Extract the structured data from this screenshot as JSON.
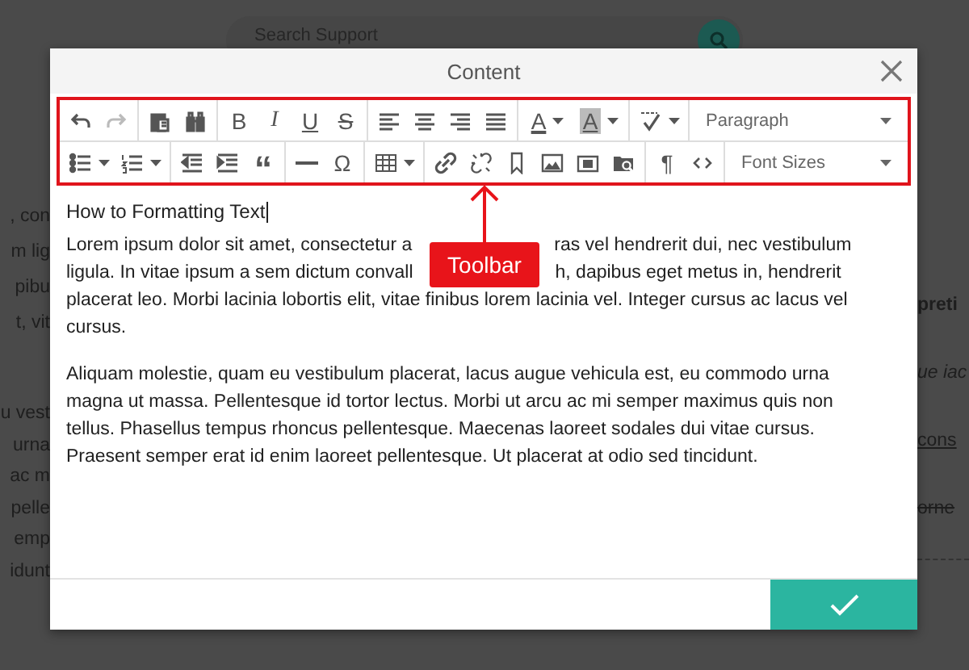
{
  "background": {
    "search": {
      "placeholder": "Search Support"
    },
    "left_fragments": [
      [
        ", con",
        "m lig",
        "pibu",
        "t, vit"
      ],
      [
        "u vest",
        "urna",
        "ac m",
        "pelle",
        "emp",
        "idunt"
      ]
    ],
    "right_fragments": [
      {
        "text": "preti",
        "kind": "bold"
      },
      {
        "text": "ue iac",
        "kind": "italic"
      },
      {
        "text": "cons",
        "kind": "underline"
      },
      {
        "text": "orne",
        "kind": "strike"
      }
    ]
  },
  "dialog": {
    "title": "Content",
    "toolbar": {
      "rows": [
        [
          [
            {
              "kind": "button",
              "disabled": false
            },
            {
              "kind": "button",
              "disabled": true
            }
          ],
          [
            {
              "kind": "button",
              "disabled": false
            },
            {
              "kind": "button",
              "disabled": false
            }
          ],
          [
            {
              "kind": "glyph",
              "glyph": "B",
              "disabled": false
            },
            {
              "kind": "glyph",
              "glyph": "I",
              "disabled": false
            },
            {
              "kind": "glyph",
              "glyph": "U",
              "disabled": false
            },
            {
              "kind": "glyph",
              "glyph": "S",
              "disabled": false
            }
          ],
          [
            {
              "kind": "button",
              "disabled": false
            },
            {
              "kind": "button",
              "disabled": false
            },
            {
              "kind": "button",
              "disabled": false
            },
            {
              "kind": "button",
              "disabled": false
            }
          ],
          [
            {
              "kind": "text-color",
              "glyph": "A",
              "disabled": false
            },
            {
              "kind": "highlight-color",
              "glyph": "A",
              "disabled": false
            }
          ],
          [
            {
              "kind": "split",
              "disabled": false
            }
          ],
          [
            {
              "kind": "select",
              "label": "Paragraph"
            }
          ]
        ],
        [
          [
            {
              "kind": "split",
              "disabled": false
            },
            {
              "kind": "split",
              "disabled": false
            }
          ],
          [
            {
              "kind": "button",
              "disabled": false
            },
            {
              "kind": "button",
              "disabled": false
            },
            {
              "kind": "glyph",
              "glyph": "“",
              "disabled": false
            }
          ],
          [
            {
              "kind": "button",
              "disabled": false
            },
            {
              "kind": "glyph",
              "glyph": "Ω",
              "disabled": false
            }
          ],
          [
            {
              "kind": "split",
              "disabled": false
            }
          ],
          [
            {
              "kind": "button",
              "disabled": false
            },
            {
              "kind": "button",
              "disabled": false
            },
            {
              "kind": "button",
              "disabled": false
            },
            {
              "kind": "button",
              "disabled": false
            },
            {
              "kind": "button",
              "disabled": false
            },
            {
              "kind": "button",
              "disabled": false
            }
          ],
          [
            {
              "kind": "glyph",
              "glyph": "¶",
              "disabled": false
            },
            {
              "kind": "button",
              "disabled": false
            }
          ],
          [
            {
              "kind": "select",
              "label": "Font Sizes"
            }
          ]
        ]
      ]
    },
    "editor": {
      "heading": "How to Formatting Text",
      "paragraphs": [
        {
          "lines": [
            {
              "segments": [
                "Lorem ipsum dolor sit amet, consectetur a",
                "ras vel hendrerit dui, nec vestibulum"
              ]
            },
            {
              "segments": [
                "ligula. In vitae ipsum a sem dictum convall",
                "h, dapibus eget metus in, hendrerit"
              ]
            },
            {
              "segments": [
                "placerat leo. Morbi lacinia lobortis elit, vitae finibus lorem lacinia vel. Integer cursus ac lacus vel"
              ]
            },
            {
              "segments": [
                "cursus."
              ]
            }
          ]
        },
        {
          "lines": [
            {
              "segments": [
                "Aliquam molestie, quam eu vestibulum placerat, lacus augue vehicula est, eu commodo urna"
              ]
            },
            {
              "segments": [
                "magna ut massa. Pellentesque id tortor lectus. Morbi ut arcu ac mi semper maximus quis non"
              ]
            },
            {
              "segments": [
                "tellus. Phasellus tempus rhoncus pellentesque. Maecenas laoreet sodales dui vitae cursus."
              ]
            },
            {
              "segments": [
                "Praesent semper erat id enim laoreet pellentesque. Ut placerat at odio sed tincidunt."
              ]
            }
          ]
        }
      ]
    },
    "annotation": {
      "label": "Toolbar"
    }
  }
}
